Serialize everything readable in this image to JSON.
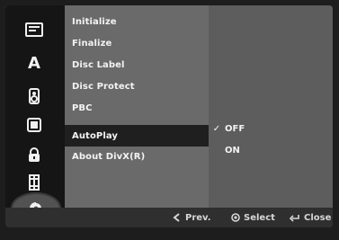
{
  "sidebar": {
    "items": [
      {
        "icon": "disc-setup-icon"
      },
      {
        "icon": "language-icon",
        "text": "A"
      },
      {
        "icon": "audio-icon"
      },
      {
        "icon": "record-icon"
      },
      {
        "icon": "lock-icon"
      },
      {
        "icon": "film-icon"
      },
      {
        "icon": "disc-icon"
      }
    ]
  },
  "menu": {
    "items": [
      {
        "label": "Initialize"
      },
      {
        "label": "Finalize"
      },
      {
        "label": "Disc Label"
      },
      {
        "label": "Disc Protect"
      },
      {
        "label": "PBC"
      },
      {
        "label": "AutoPlay"
      },
      {
        "label": "About DivX(R)"
      }
    ],
    "selected_index": 5
  },
  "options": {
    "items": [
      {
        "label": "OFF",
        "checked": true
      },
      {
        "label": "ON",
        "checked": false
      }
    ]
  },
  "footer": {
    "prev": {
      "icon": "left-arrow-icon",
      "label": "Prev."
    },
    "select": {
      "icon": "select-icon",
      "label": "Select"
    },
    "close": {
      "icon": "return-icon",
      "label": "Close"
    }
  }
}
